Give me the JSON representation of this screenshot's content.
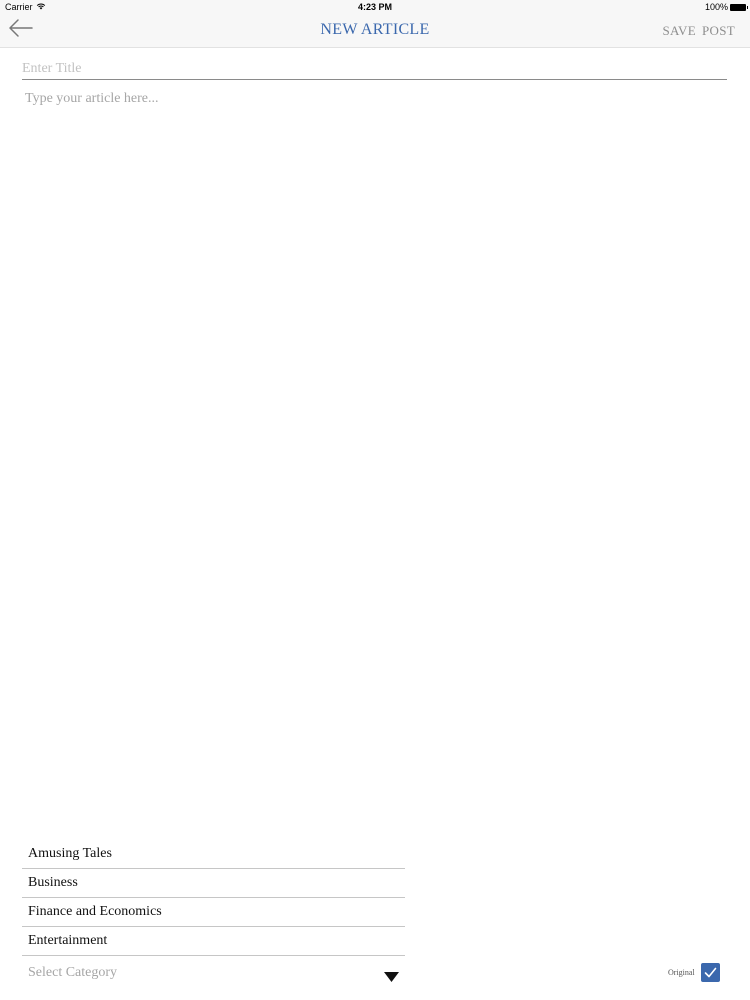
{
  "status_bar": {
    "carrier": "Carrier",
    "time": "4:23 PM",
    "battery": "100%"
  },
  "nav": {
    "title": "NEW ARTICLE",
    "save_label": "SAVE",
    "post_label": "POST"
  },
  "form": {
    "title_value": "",
    "title_placeholder": "Enter Title",
    "article_value": "",
    "article_placeholder": "Type your article here..."
  },
  "category": {
    "options": [
      "Amusing Tales",
      "Business",
      "Finance and Economics",
      "Entertainment"
    ],
    "select_placeholder": "Select Category"
  },
  "original": {
    "label": "Original",
    "checked": true
  },
  "colors": {
    "accent": "#3b68ad",
    "muted_text": "#8e8e8e",
    "placeholder": "#a6a6a6",
    "nav_background": "#f7f7f7"
  }
}
